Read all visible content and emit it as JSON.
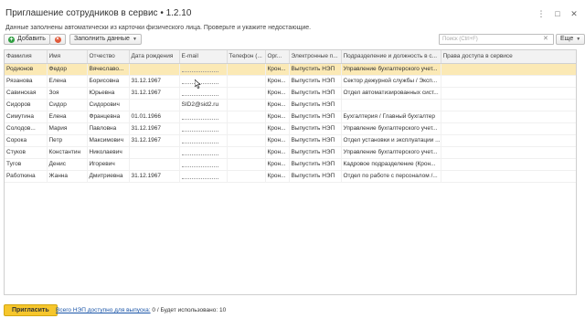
{
  "window": {
    "title": "Приглашение сотрудников в сервис • 1.2.10",
    "controls": [
      "⋮",
      "□",
      "✕"
    ]
  },
  "subtitle": "Данные заполнены автоматически из карточки физического лица. Проверьте и укажите недостающие.",
  "toolbar": {
    "add_label": "Добавить",
    "fill_label": "Заполнить данные",
    "search_placeholder": "Поиск (Ctrl+F)",
    "more_label": "Еще"
  },
  "table": {
    "columns": [
      "Фамилия",
      "Имя",
      "Отчество",
      "Дата рождения",
      "E-mail",
      "Телефон (...",
      "Орг...",
      "Электронные п...",
      "Подразделение и должность в с...",
      "Права доступа в сервисе"
    ],
    "rows": [
      {
        "surname": "Родионов",
        "name": "Федор",
        "patronymic": "Вячеславо...",
        "birth": "",
        "email": "",
        "phone": "",
        "org": "Крон...",
        "nep": "Выпустить НЭП",
        "dept": "Управление бухгалтерского учет...",
        "rights": "",
        "selected": true
      },
      {
        "surname": "Рязанова",
        "name": "Елена",
        "patronymic": "Борисовна",
        "birth": "31.12.1967",
        "email": "",
        "phone": "",
        "org": "Крон...",
        "nep": "Выпустить НЭП",
        "dept": "Сектор дежурной службы / Эксп...",
        "rights": ""
      },
      {
        "surname": "Савинская",
        "name": "Зоя",
        "patronymic": "Юрьевна",
        "birth": "31.12.1967",
        "email": "",
        "phone": "",
        "org": "Крон...",
        "nep": "Выпустить НЭП",
        "dept": "Отдел автоматизированных сист...",
        "rights": ""
      },
      {
        "surname": "Сидоров",
        "name": "Сидор",
        "patronymic": "Сидорович",
        "birth": "",
        "email": "SID2@sid2.ru",
        "phone": "",
        "org": "Крон...",
        "nep": "Выпустить НЭП",
        "dept": "",
        "rights": ""
      },
      {
        "surname": "Симутина",
        "name": "Елена",
        "patronymic": "Францевна",
        "birth": "01.01.1966",
        "email": "",
        "phone": "",
        "org": "Крон...",
        "nep": "Выпустить НЭП",
        "dept": "Бухгалтерия / Главный бухгалтер",
        "rights": ""
      },
      {
        "surname": "Солодов...",
        "name": "Мария",
        "patronymic": "Павловна",
        "birth": "31.12.1967",
        "email": "",
        "phone": "",
        "org": "Крон...",
        "nep": "Выпустить НЭП",
        "dept": "Управление бухгалтерского учет...",
        "rights": ""
      },
      {
        "surname": "Сорока",
        "name": "Петр",
        "patronymic": "Максимович",
        "birth": "31.12.1967",
        "email": "",
        "phone": "",
        "org": "Крон...",
        "nep": "Выпустить НЭП",
        "dept": "Отдел установки и эксплуатации ...",
        "rights": ""
      },
      {
        "surname": "Стуков",
        "name": "Константин",
        "patronymic": "Николаевич",
        "birth": "",
        "email": "",
        "phone": "",
        "org": "Крон...",
        "nep": "Выпустить НЭП",
        "dept": "Управление бухгалтерского учет...",
        "rights": ""
      },
      {
        "surname": "Тугов",
        "name": "Денис",
        "patronymic": "Игоревич",
        "birth": "",
        "email": "",
        "phone": "",
        "org": "Крон...",
        "nep": "Выпустить НЭП",
        "dept": "Кадровое подразделение (Крон...",
        "rights": ""
      },
      {
        "surname": "Работкина",
        "name": "Жанна",
        "patronymic": "Дмитриевна",
        "birth": "31.12.1967",
        "email": "",
        "phone": "",
        "org": "Крон...",
        "nep": "Выпустить НЭП",
        "dept": "Отдел по работе с персоналом /...",
        "rights": ""
      }
    ]
  },
  "footer": {
    "invite_label": "Пригласить",
    "nep_link": "Всего НЭП доступно для выпуска:",
    "nep_available": "0",
    "nep_used_label": "/ Будет использовано:",
    "nep_used": "10"
  },
  "colors": {
    "selected_row": "#fbe9b5",
    "invite_button": "#f6c62c",
    "add_icon": "#2f9e41",
    "delete_icon": "#e05a3a"
  }
}
